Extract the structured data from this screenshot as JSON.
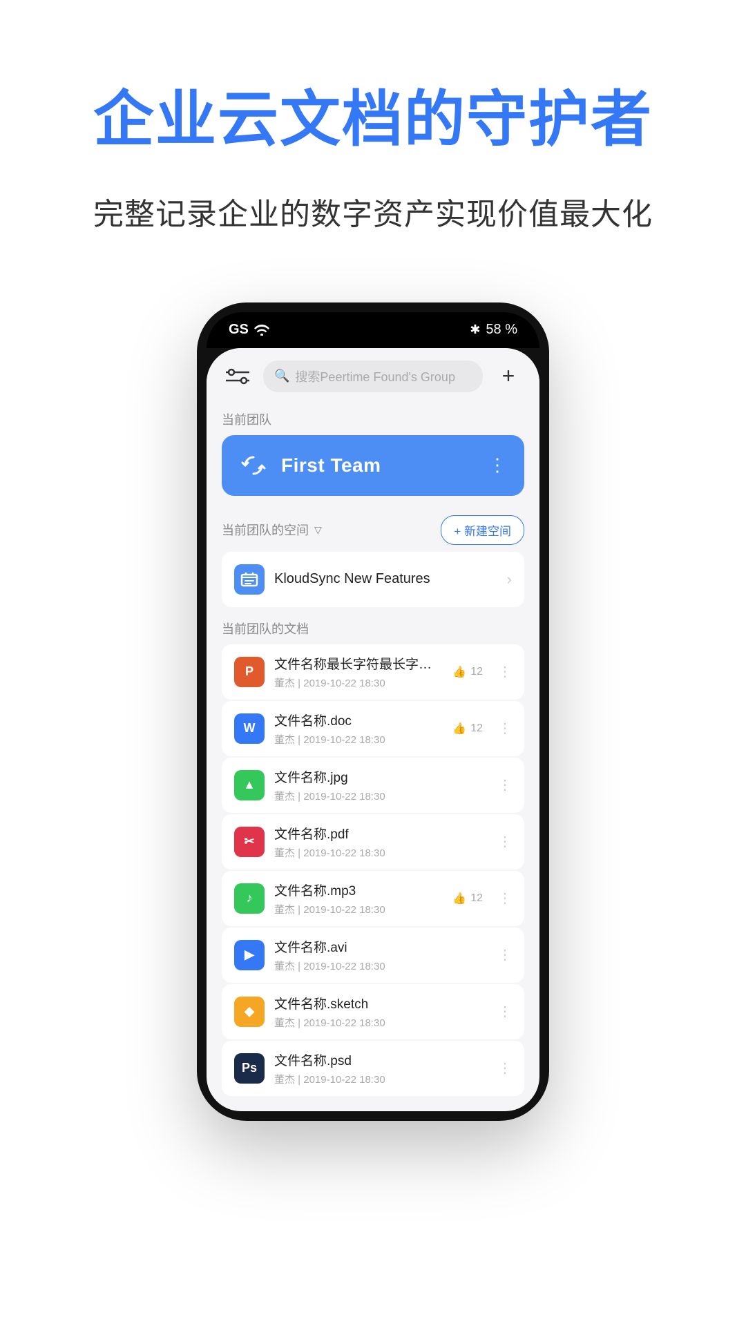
{
  "hero": {
    "title": "企业云文档的守护者",
    "subtitle": "完整记录企业的数字资产实现价值最大化"
  },
  "status_bar": {
    "carrier": "GS",
    "wifi": true,
    "bluetooth": true,
    "battery": "58 %"
  },
  "search": {
    "placeholder": "搜索Peertime Found's Group"
  },
  "current_team_label": "当前团队",
  "team": {
    "name": "First Team"
  },
  "space_section_label": "当前团队的空间",
  "new_space_btn": "+ 新建空间",
  "spaces": [
    {
      "name": "KloudSync New Features",
      "icon_color": "#4d8ef5"
    }
  ],
  "docs_section_label": "当前团队的文档",
  "files": [
    {
      "name": "文件名称最长字符最长字符最长...ppt",
      "type": "ppt",
      "icon_label": "P",
      "author": "董杰",
      "date": "2019-10-22  18:30",
      "likes": 12,
      "show_likes": true
    },
    {
      "name": "文件名称.doc",
      "type": "doc",
      "icon_label": "W",
      "author": "董杰",
      "date": "2019-10-22  18:30",
      "likes": 12,
      "show_likes": true
    },
    {
      "name": "文件名称.jpg",
      "type": "jpg",
      "icon_label": "▲",
      "author": "董杰",
      "date": "2019-10-22  18:30",
      "likes": null,
      "show_likes": false
    },
    {
      "name": "文件名称.pdf",
      "type": "pdf",
      "icon_label": "✂",
      "author": "董杰",
      "date": "2019-10-22  18:30",
      "likes": null,
      "show_likes": false
    },
    {
      "name": "文件名称.mp3",
      "type": "mp3",
      "icon_label": "♪",
      "author": "董杰",
      "date": "2019-10-22  18:30",
      "likes": 12,
      "show_likes": true
    },
    {
      "name": "文件名称.avi",
      "type": "avi",
      "icon_label": "▶",
      "author": "董杰",
      "date": "2019-10-22  18:30",
      "likes": null,
      "show_likes": false
    },
    {
      "name": "文件名称.sketch",
      "type": "sketch",
      "icon_label": "◆",
      "author": "董杰",
      "date": "2019-10-22  18:30",
      "likes": null,
      "show_likes": false
    },
    {
      "name": "文件名称.psd",
      "type": "psd",
      "icon_label": "Ps",
      "author": "董杰",
      "date": "2019-10-22  18:30",
      "likes": null,
      "show_likes": false
    }
  ],
  "icons": {
    "filter": "⇌",
    "search": "🔍",
    "plus": "+",
    "more_vertical": "⋮",
    "refresh": "↻",
    "chevron_down": "▽",
    "chevron_right": "›",
    "like": "👍"
  }
}
